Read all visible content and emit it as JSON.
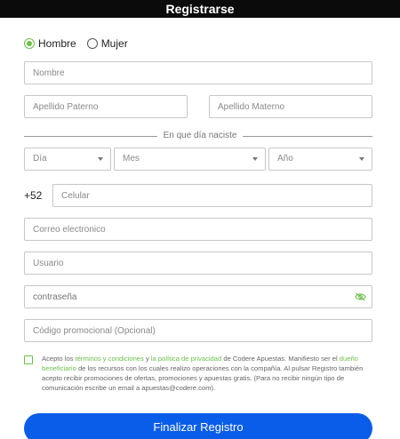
{
  "header": {
    "title": "Registrarse"
  },
  "gender": {
    "options": [
      {
        "label": "Hombre",
        "selected": true
      },
      {
        "label": "Mujer",
        "selected": false
      }
    ]
  },
  "form": {
    "nombre_placeholder": "Nombre",
    "apellido_paterno_placeholder": "Apellido Paterno",
    "apellido_materno_placeholder": "Apellido Materno",
    "dob_label": "En que día naciste",
    "dob": {
      "day": "Día",
      "month": "Mes",
      "year": "Año"
    },
    "phone_prefix": "+52",
    "celular_placeholder": "Celular",
    "correo_placeholder": "Correo electronico",
    "usuario_placeholder": "Usuario",
    "password_placeholder": "contraseña",
    "promo_placeholder": "Código promocional (Opcional)"
  },
  "terms": {
    "t1": "Acepto los ",
    "link_terms": "términos y condiciones",
    "t2": " y ",
    "link_privacy": "la política de privacidad",
    "t3": " de Codere Apuestas. Manifiesto ser el ",
    "link_owner": "dueño beneficiario",
    "t4": " de los recursos con los cuales realizo operaciones con la compañía. Al pulsar Registro también acepto recibir promociones de ofertas, promociones y apuestas gratis. (Para no recibir ningún tipo de comunicación escribe un email a apuestas@codere.com)."
  },
  "submit_label": "Finalizar Registro",
  "colors": {
    "accent_green": "#6cc04a",
    "button_blue": "#0a5de8",
    "header_bg": "#0b0b0b"
  }
}
